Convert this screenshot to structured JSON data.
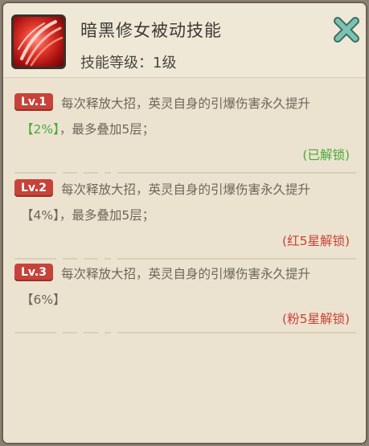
{
  "header": {
    "title": "暗黑修女被动技能",
    "level_text": "技能等级：1级",
    "icon": "red-slash-skill-icon",
    "close_icon": "close-x-icon"
  },
  "colors": {
    "panel_bg": "#efe8d6",
    "badge_red": "#c7433a",
    "unlocked_green": "#4aa83a",
    "locked_red": "#c94237",
    "close_teal": "#5fa79a"
  },
  "levels": [
    {
      "badge": "Lv.1",
      "text1": "每次释放大招，英灵自身的引爆伤害永久提升",
      "value": "【2%】",
      "text2": "，最多叠加5层；",
      "status": "(已解锁)"
    },
    {
      "badge": "Lv.2",
      "text1": "每次释放大招，英灵自身的引爆伤害永久提升",
      "value": "【4%】",
      "text2": "，最多叠加5层；",
      "status": "(红5星解锁)"
    },
    {
      "badge": "Lv.3",
      "text1": "每次释放大招，英灵自身的引爆伤害永久提升",
      "value": "【6%】",
      "text2": "",
      "status": "(粉5星解锁)"
    }
  ]
}
